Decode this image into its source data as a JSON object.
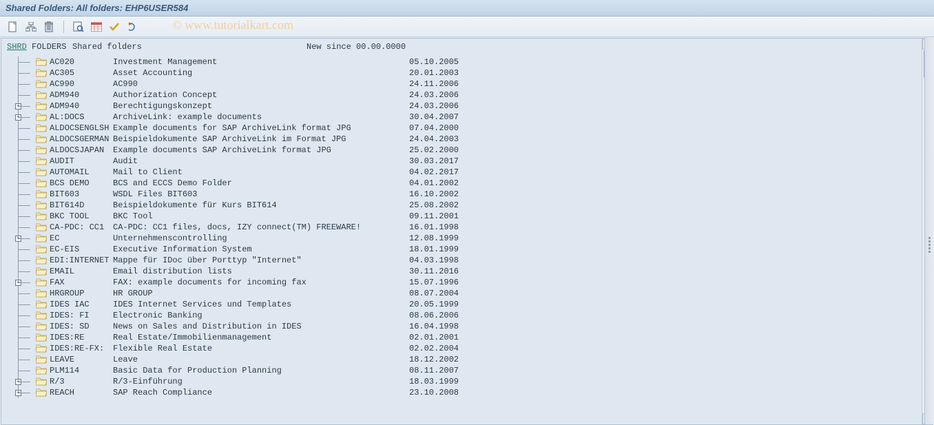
{
  "title": "Shared Folders: All folders: EHP6USER584",
  "watermark": "© www.tutorialkart.com",
  "root": {
    "shrd": "SHRD",
    "folders": "FOLDERS",
    "label": "Shared folders",
    "new_since": "New since 00.00.0000"
  },
  "toolbar_icons": [
    {
      "name": "document-icon"
    },
    {
      "name": "hierarchy-icon"
    },
    {
      "name": "delete-icon"
    },
    {
      "name": "find-icon"
    },
    {
      "name": "calendar-icon"
    },
    {
      "name": "check-icon"
    },
    {
      "name": "refresh-icon"
    }
  ],
  "rows": [
    {
      "exp": false,
      "code": "AC020",
      "desc": "Investment Management",
      "date": "05.10.2005"
    },
    {
      "exp": false,
      "code": "AC305",
      "desc": "Asset Accounting",
      "date": "20.01.2003"
    },
    {
      "exp": false,
      "code": "AC990",
      "desc": "AC990",
      "date": "24.11.2006"
    },
    {
      "exp": false,
      "code": "ADM940",
      "desc": "Authorization Concept",
      "date": "24.03.2006"
    },
    {
      "exp": true,
      "code": "ADM940",
      "desc": "Berechtigungskonzept",
      "date": "24.03.2006"
    },
    {
      "exp": true,
      "code": "AL:DOCS",
      "desc": "ArchiveLink: example documents",
      "date": "30.04.2007"
    },
    {
      "exp": false,
      "code": "ALDOCSENGLSH",
      "desc": "Example documents for SAP ArchiveLink format JPG",
      "date": "07.04.2000"
    },
    {
      "exp": false,
      "code": "ALDOCSGERMAN",
      "desc": "Beispieldokumente SAP ArchiveLink im Format JPG",
      "date": "24.04.2003"
    },
    {
      "exp": false,
      "code": "ALDOCSJAPAN",
      "desc": "Example documents SAP ArchiveLink format JPG",
      "date": "25.02.2000"
    },
    {
      "exp": false,
      "code": "AUDIT",
      "desc": "Audit",
      "date": "30.03.2017"
    },
    {
      "exp": false,
      "code": "AUTOMAIL",
      "desc": "Mail to Client",
      "date": "04.02.2017"
    },
    {
      "exp": false,
      "code": "BCS DEMO",
      "desc": "BCS and ECCS Demo Folder",
      "date": "04.01.2002"
    },
    {
      "exp": false,
      "code": "BIT603",
      "desc": "WSDL Files  BIT603",
      "date": "16.10.2002"
    },
    {
      "exp": false,
      "code": "BIT614D",
      "desc": "Beispieldokumente für Kurs BIT614",
      "date": "25.08.2002"
    },
    {
      "exp": false,
      "code": "BKC TOOL",
      "desc": "BKC Tool",
      "date": "09.11.2001"
    },
    {
      "exp": false,
      "code": "CA-PDC: CC1",
      "desc": "CA-PDC: CC1 files, docs, IZY connect(TM) FREEWARE!",
      "date": "16.01.1998"
    },
    {
      "exp": true,
      "code": "EC",
      "desc": "Unternehmenscontrolling",
      "date": "12.08.1999"
    },
    {
      "exp": false,
      "code": "EC-EIS",
      "desc": "Executive Information System",
      "date": "18.01.1999"
    },
    {
      "exp": false,
      "code": "EDI:INTERNET",
      "desc": "Mappe für IDoc über Porttyp \"Internet\"",
      "date": "04.03.1998"
    },
    {
      "exp": false,
      "code": "EMAIL",
      "desc": "Email distribution lists",
      "date": "30.11.2016"
    },
    {
      "exp": true,
      "code": "FAX",
      "desc": "FAX: example documents for incoming fax",
      "date": "15.07.1996"
    },
    {
      "exp": false,
      "code": "HRGROUP",
      "desc": "HR GROUP",
      "date": "08.07.2004"
    },
    {
      "exp": false,
      "code": "IDES IAC",
      "desc": "IDES Internet Services und Templates",
      "date": "20.05.1999"
    },
    {
      "exp": false,
      "code": "IDES: FI",
      "desc": "Electronic Banking",
      "date": "08.06.2006"
    },
    {
      "exp": false,
      "code": "IDES: SD",
      "desc": "News on Sales and Distribution in IDES",
      "date": "16.04.1998"
    },
    {
      "exp": false,
      "code": "IDES:RE",
      "desc": "Real Estate/Immobilienmanagement",
      "date": "02.01.2001"
    },
    {
      "exp": false,
      "code": "IDES:RE-FX:",
      "desc": "Flexible Real Estate",
      "date": "02.02.2004"
    },
    {
      "exp": false,
      "code": "LEAVE",
      "desc": "Leave",
      "date": "18.12.2002"
    },
    {
      "exp": false,
      "code": "PLM114",
      "desc": "Basic Data for Production Planning",
      "date": "08.11.2007"
    },
    {
      "exp": true,
      "code": "R/3",
      "desc": "R/3-Einführung",
      "date": "18.03.1999"
    },
    {
      "exp": true,
      "code": "REACH",
      "desc": "SAP Reach Compliance",
      "date": "23.10.2008"
    }
  ]
}
